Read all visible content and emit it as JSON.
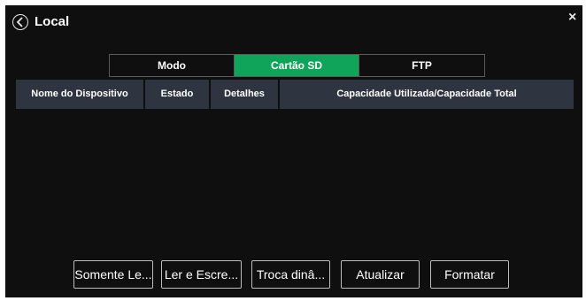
{
  "dialog": {
    "title": "Local",
    "close_label": "×"
  },
  "tabs": [
    {
      "label": "Modo",
      "active": false
    },
    {
      "label": "Cartão SD",
      "active": true
    },
    {
      "label": "FTP",
      "active": false
    }
  ],
  "table": {
    "columns": [
      "Nome do Dispositivo",
      "Estado",
      "Detalhes",
      "Capacidade Utilizada/Capacidade Total"
    ],
    "rows": []
  },
  "buttons": {
    "read_only": "Somente Le...",
    "read_write": "Ler e Escre...",
    "hot_swap": "Troca dinâ...",
    "refresh": "Atualizar",
    "format": "Formatar"
  },
  "colors": {
    "background": "#0f0f0f",
    "accent": "#10a35a",
    "header_cell": "#2f3540"
  },
  "icons": {
    "back": "back-arrow-icon",
    "close": "close-icon"
  }
}
